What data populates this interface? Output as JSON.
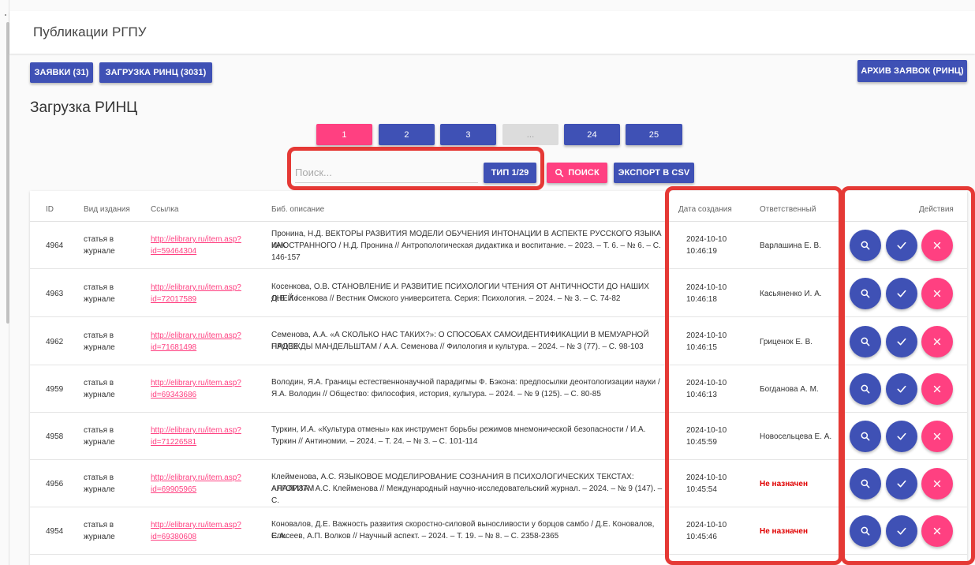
{
  "app": {
    "title": "Публикации РГПУ"
  },
  "toolbar": {
    "requests_label": "ЗАЯВКИ (31)",
    "rinc_label": "ЗАГРУЗКА РИНЦ (3031)",
    "archive_label": "АРХИВ ЗАЯВОК (РИНЦ)"
  },
  "section": {
    "title": "Загрузка РИНЦ"
  },
  "pagination": {
    "pages": [
      "1",
      "2",
      "3",
      "...",
      "24",
      "25"
    ],
    "current": "1"
  },
  "search": {
    "placeholder": "Поиск...",
    "type_label": "ТИП 1/29",
    "search_label": "ПОИСК",
    "export_label": "ЭКСПОРТ В CSV"
  },
  "table": {
    "headers": {
      "id": "ID",
      "kind": "Вид издания",
      "link": "Ссылка",
      "bib": "Биб. описание",
      "date": "Дата создания",
      "responsible": "Ответственный",
      "actions": "Действия"
    },
    "rows": [
      {
        "id": "4964",
        "kind1": "статья в",
        "kind2": "журнале",
        "link1": "http://elibrary.ru/item.asp?",
        "link2": "id=59464304",
        "bib1": "Пронина, Н.Д. ВЕКТОРЫ РАЗВИТИЯ МОДЕЛИ ОБУЧЕНИЯ ИНТОНАЦИИ В АСПЕКТЕ РУССКОГО ЯЗЫКА КАК",
        "bib2": "ИНОСТРАННОГО / Н.Д. Пронина // Антропологическая дидактика и воспитание. – 2023. – Т. 6. – № 6. – С.",
        "bib3": "146-157",
        "date": "2024-10-10",
        "time": "10:46:19",
        "responsible": "Варлашина Е. В.",
        "unassigned": false
      },
      {
        "id": "4963",
        "kind1": "статья в",
        "kind2": "журнале",
        "link1": "http://elibrary.ru/item.asp?",
        "link2": "id=72017589",
        "bib1": "Косенкова, О.В. СТАНОВЛЕНИЕ И РАЗВИТИЕ ПСИХОЛОГИИ ЧТЕНИЯ ОТ АНТИЧНОСТИ ДО НАШИХ ДНЕЙ /",
        "bib2": "О.В. Косенкова // Вестник Омского университета. Серия: Психология. – 2024. – № 3. – С. 74-82",
        "bib3": "",
        "date": "2024-10-10",
        "time": "10:46:18",
        "responsible": "Касьяненко И. А.",
        "unassigned": false
      },
      {
        "id": "4962",
        "kind1": "статья в",
        "kind2": "журнале",
        "link1": "http://elibrary.ru/item.asp?",
        "link2": "id=71681498",
        "bib1": "Семенова, А.А. «А СКОЛЬКО НАС ТАКИХ?»: О СПОСОБАХ САМОИДЕНТИФИКАЦИИ В МЕМУАРНОЙ ПРОЗЕ",
        "bib2": "НАДЕЖДЫ МАНДЕЛЬШТАМ / А.А. Семенова // Филология и культура. – 2024. – № 3 (77). – С. 98-103",
        "bib3": "",
        "date": "2024-10-10",
        "time": "10:46:15",
        "responsible": "Гриценок Е. В.",
        "unassigned": false
      },
      {
        "id": "4959",
        "kind1": "статья в",
        "kind2": "журнале",
        "link1": "http://elibrary.ru/item.asp?",
        "link2": "id=69343686",
        "bib1": "Володин, Я.А. Границы естественнонаучной парадигмы Ф. Бэкона: предпосылки деонтологизации науки /",
        "bib2": "Я.А. Володин // Общество: философия, история, культура. – 2024. – № 9 (125). – С. 80-85",
        "bib3": "",
        "date": "2024-10-10",
        "time": "10:46:13",
        "responsible": "Богданова А. М.",
        "unassigned": false
      },
      {
        "id": "4958",
        "kind1": "статья в",
        "kind2": "журнале",
        "link1": "http://elibrary.ru/item.asp?",
        "link2": "id=71226581",
        "bib1": "Туркин, И.А. «Культура отмены» как инструмент борьбы режимов мнемонической безопасности / И.А.",
        "bib2": "Туркин // Антиномии. – 2024. – Т. 24. – № 3. – С. 101-114",
        "bib3": "",
        "date": "2024-10-10",
        "time": "10:45:59",
        "responsible": "Новосельцева Е. А.",
        "unassigned": false
      },
      {
        "id": "4956",
        "kind1": "статья в",
        "kind2": "журнале",
        "link1": "http://elibrary.ru/item.asp?",
        "link2": "id=69905965",
        "bib1": "Клейменова, А.С. ЯЗЫКОВОЕ МОДЕЛИРОВАНИЕ СОЗНАНИЯ В ПСИХОЛОГИЧЕСКИХ ТЕКСТАХ: АЛГОРИТМ",
        "bib2": "АНАЛИЗА / А.С. Клейменова // Международный научно-исследовательский журнал. – 2024. – № 9 (147). – С.",
        "bib3": "",
        "date": "2024-10-10",
        "time": "10:45:54",
        "responsible": "Не назначен",
        "unassigned": true
      },
      {
        "id": "4954",
        "kind1": "статья в",
        "kind2": "журнале",
        "link1": "http://elibrary.ru/item.asp?",
        "link2": "id=69380608",
        "bib1": "Коновалов, Д.Е. Важность развития скоростно-силовой выносливости у борцов самбо / Д.Е. Коновалов, С.А.",
        "bib2": "Елисеев, А.П. Волков // Научный аспект. – 2024. – Т. 19. – № 8. – С. 2358-2365",
        "bib3": "",
        "date": "2024-10-10",
        "time": "10:45:46",
        "responsible": "Не назначен",
        "unassigned": true
      }
    ]
  },
  "colors": {
    "primary": "#3f51b5",
    "accent": "#ff4081",
    "highlight": "#e53935",
    "unassigned": "#e00000"
  },
  "icons": {
    "view": "search-icon",
    "approve": "check-icon",
    "reject": "close-icon"
  }
}
